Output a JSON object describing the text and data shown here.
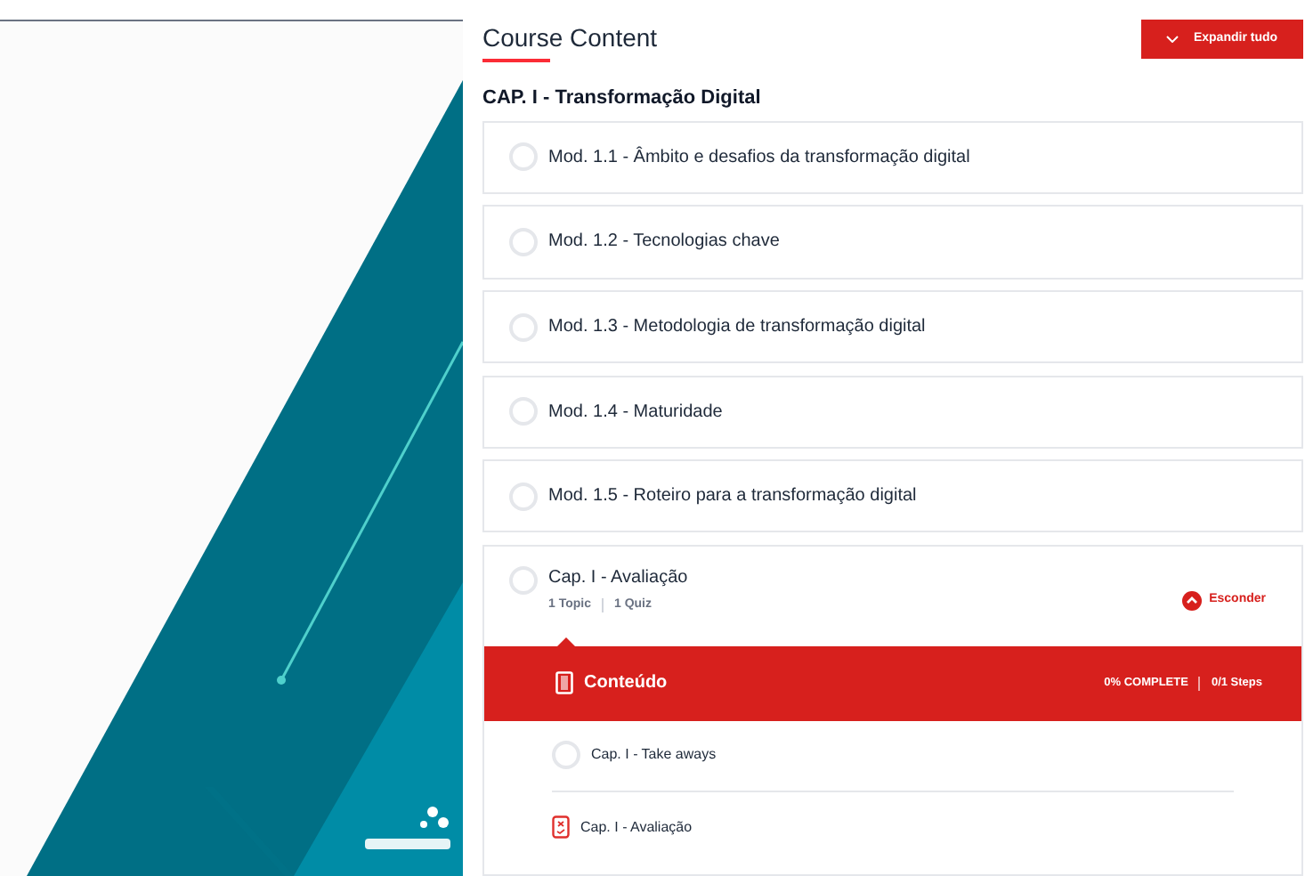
{
  "header": {
    "title": "Course Content",
    "expand_button": "Expandir tudo"
  },
  "section": {
    "title": "CAP. I - Transformação Digital"
  },
  "modules": [
    {
      "title": "Mod. 1.1 - Âmbito e desafios da transformação digital",
      "completed": false
    },
    {
      "title": "Mod. 1.2 - Tecnologias chave",
      "completed": false
    },
    {
      "title": "Mod. 1.3 - Metodologia de transformação digital",
      "completed": false
    },
    {
      "title": "Mod. 1.4 - Maturidade",
      "completed": false
    },
    {
      "title": "Mod. 1.5 - Roteiro para a transformação digital",
      "completed": false
    }
  ],
  "expanded_module": {
    "title": "Cap. I - Avaliação",
    "completed": false,
    "topics": "1 Topic",
    "quizzes": "1 Quiz",
    "toggle": "Esconder",
    "expanded": true,
    "content_bar": {
      "title": "Conteúdo",
      "progress": "0% COMPLETE",
      "steps": "0/1 Steps"
    },
    "lessons": [
      {
        "kind": "topic",
        "title": "Cap. I - Take aways",
        "completed": false
      },
      {
        "kind": "quiz",
        "title": "Cap. I - Avaliação"
      }
    ]
  }
}
